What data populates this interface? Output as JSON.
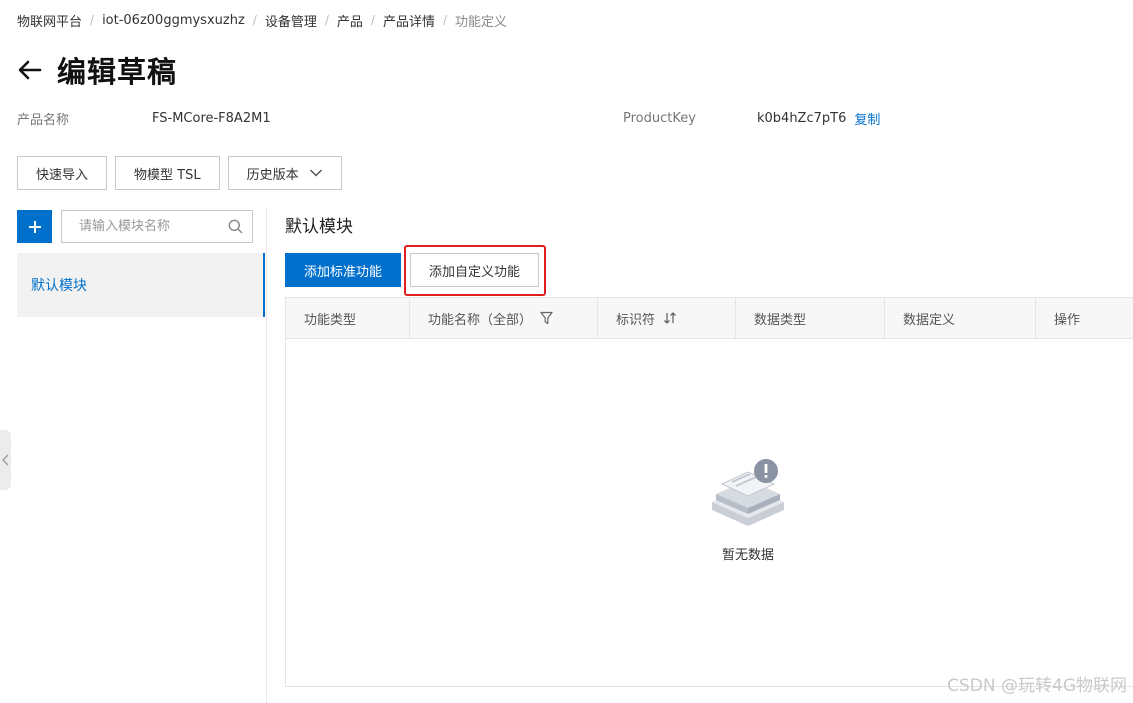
{
  "breadcrumb": {
    "items": [
      "物联网平台",
      "iot-06z00ggmysxuzhz",
      "设备管理",
      "产品",
      "产品详情"
    ],
    "current": "功能定义"
  },
  "header": {
    "title": "编辑草稿"
  },
  "product": {
    "name_label": "产品名称",
    "name_value": "FS-MCore-F8A2M1",
    "key_label": "ProductKey",
    "key_value": "k0b4hZc7pT6",
    "copy_label": "复制"
  },
  "toolbar": {
    "quick_import": "快速导入",
    "tsl": "物模型 TSL",
    "history": "历史版本"
  },
  "sidebar": {
    "search_placeholder": "请输入模块名称",
    "modules": [
      {
        "label": "默认模块",
        "selected": true
      }
    ]
  },
  "main": {
    "module_title": "默认模块",
    "add_standard": "添加标准功能",
    "add_custom": "添加自定义功能",
    "columns": [
      "功能类型",
      "功能名称（全部）",
      "标识符",
      "数据类型",
      "数据定义",
      "操作"
    ],
    "empty_text": "暂无数据"
  },
  "watermark": "CSDN @玩转4G物联网",
  "colors": {
    "primary": "#0070cc",
    "highlight": "#e02020"
  }
}
